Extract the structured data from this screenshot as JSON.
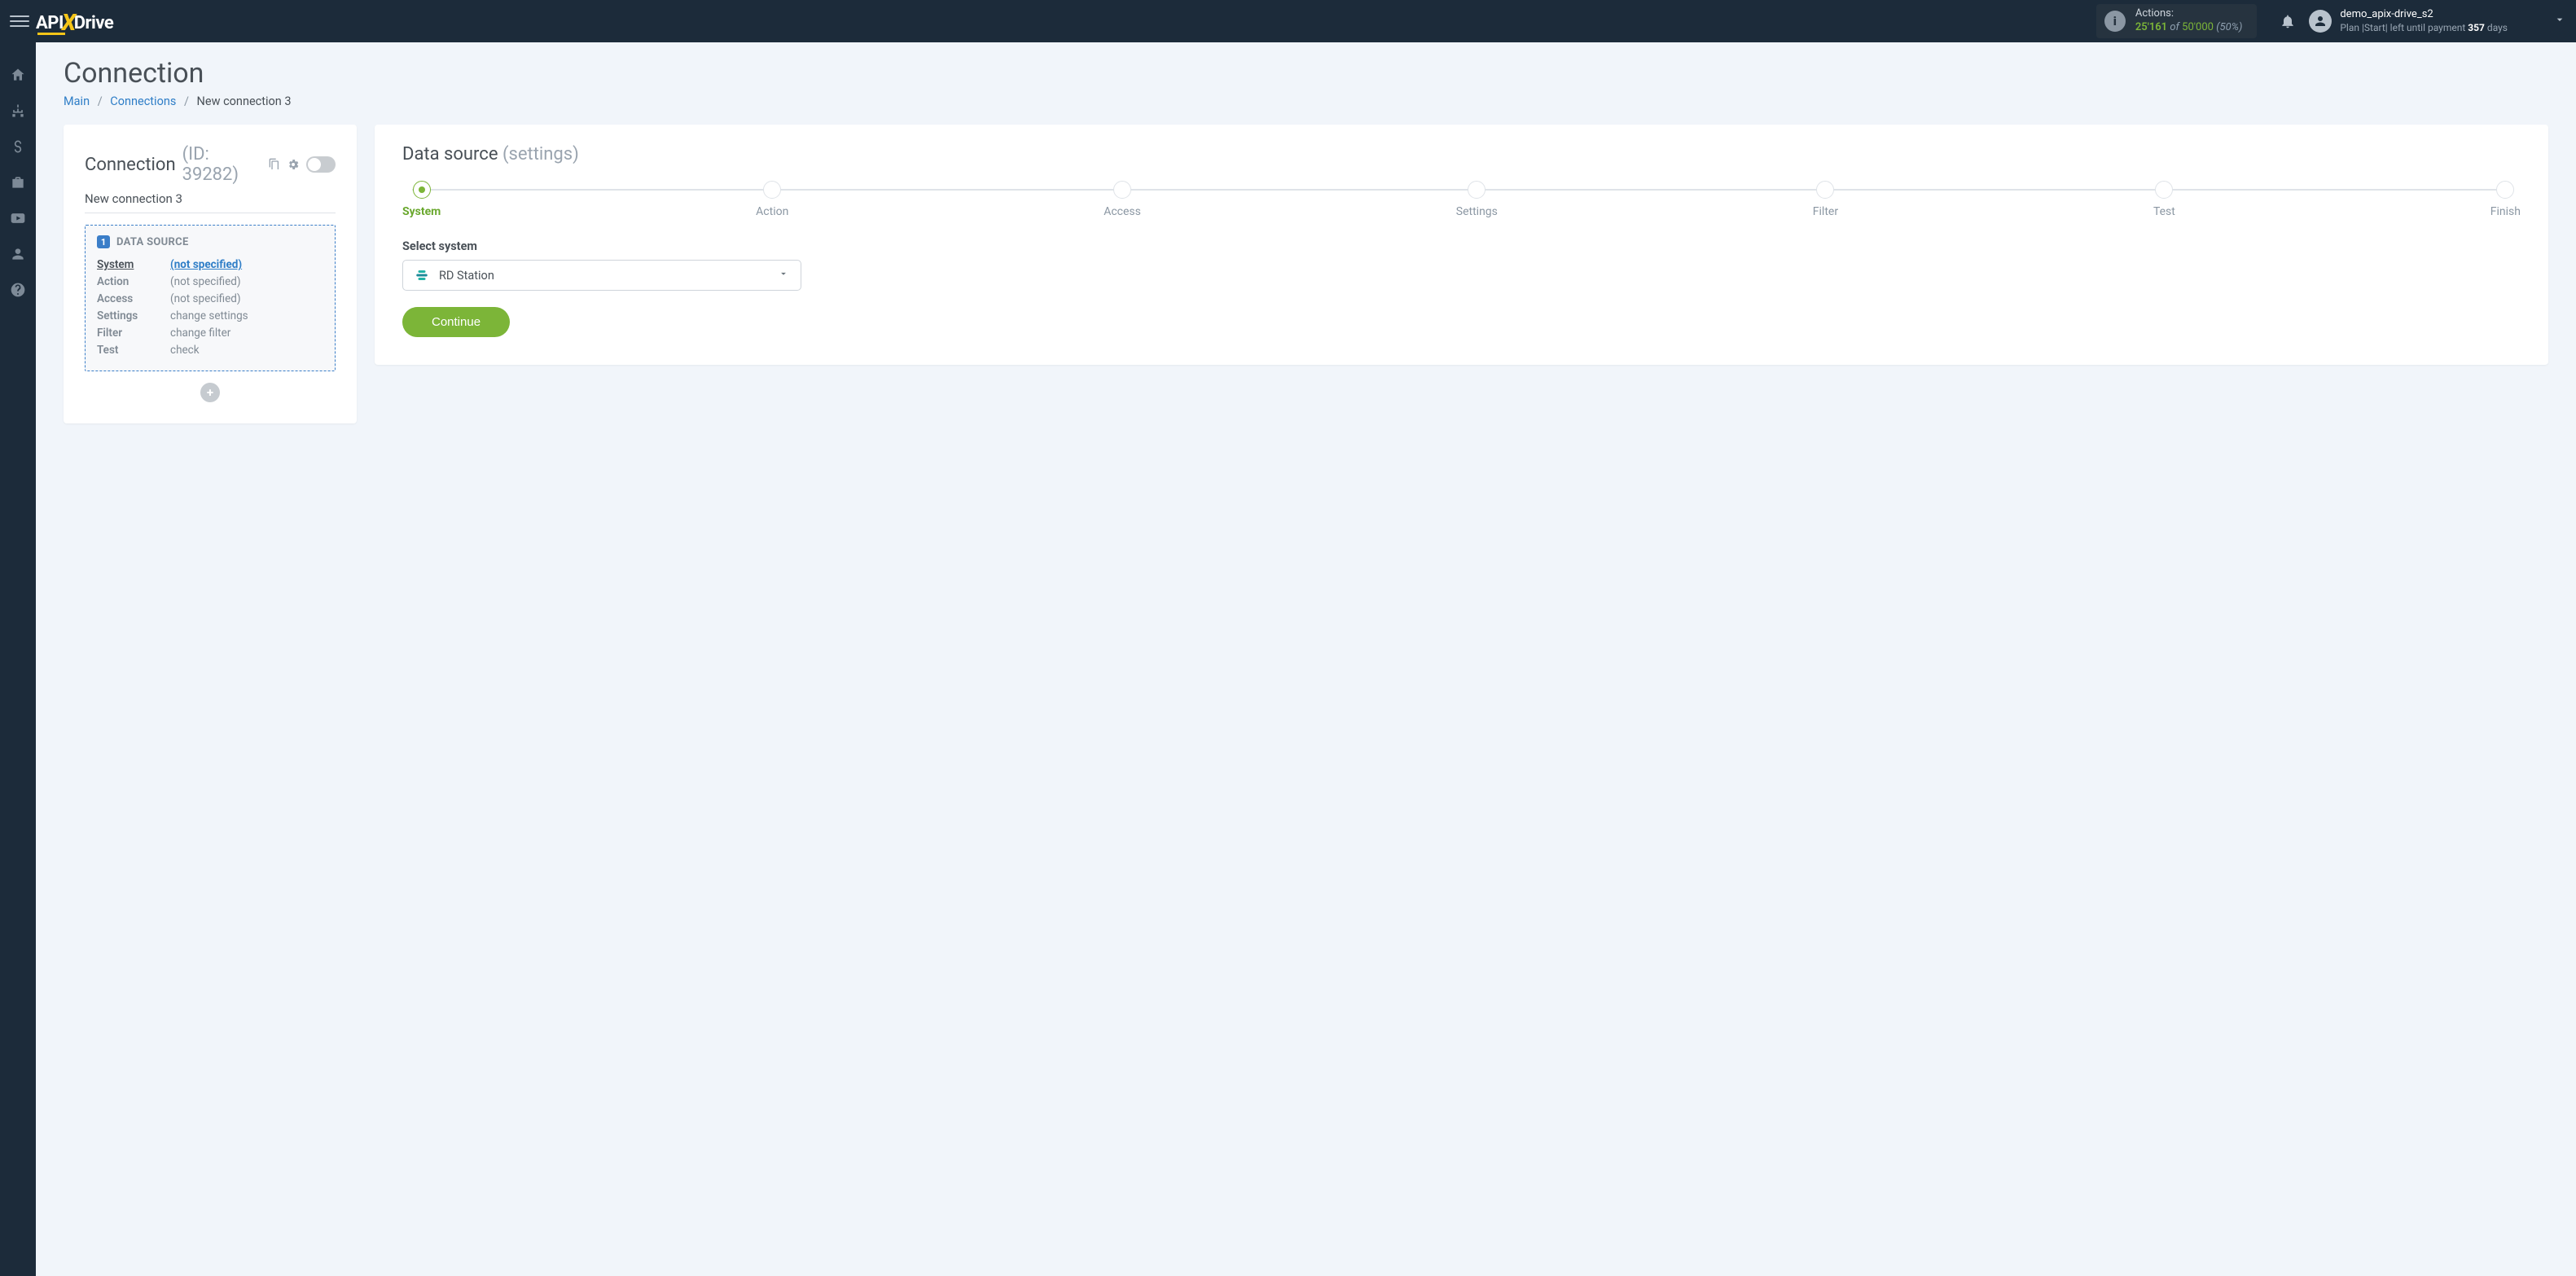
{
  "header": {
    "actions_label": "Actions:",
    "actions_used": "25'161",
    "actions_of": "of",
    "actions_total": "50'000",
    "actions_pct": "(50%)",
    "username": "demo_apix-drive_s2",
    "plan_prefix": "Plan |Start| left until payment",
    "plan_days_num": "357",
    "plan_days_word": "days"
  },
  "page": {
    "title": "Connection",
    "breadcrumb": {
      "main": "Main",
      "connections": "Connections",
      "current": "New connection 3"
    }
  },
  "conn_panel": {
    "heading": "Connection",
    "id_label": "(ID: 39282)",
    "name": "New connection 3",
    "ds_badge": "1",
    "ds_title": "DATA SOURCE",
    "rows": {
      "system": {
        "k": "System",
        "v": "(not specified)"
      },
      "action": {
        "k": "Action",
        "v": "(not specified)"
      },
      "access": {
        "k": "Access",
        "v": "(not specified)"
      },
      "settings": {
        "k": "Settings",
        "v": "change settings"
      },
      "filter": {
        "k": "Filter",
        "v": "change filter"
      },
      "test": {
        "k": "Test",
        "v": "check"
      }
    }
  },
  "right": {
    "title": "Data source",
    "subtitle": "(settings)",
    "steps": [
      "System",
      "Action",
      "Access",
      "Settings",
      "Filter",
      "Test",
      "Finish"
    ],
    "field_label": "Select system",
    "selected_system": "RD Station",
    "continue": "Continue"
  }
}
